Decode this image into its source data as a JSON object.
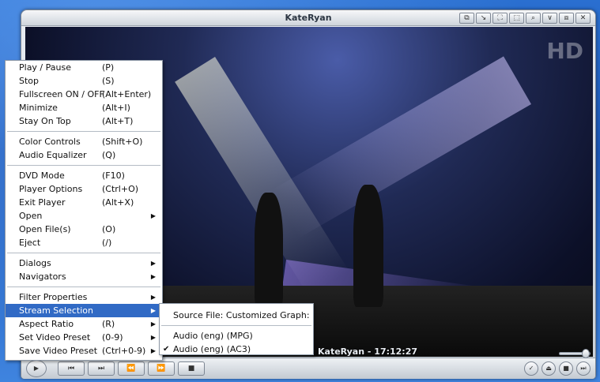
{
  "window": {
    "title": "KateRyan",
    "title_buttons": [
      "⧉",
      "↘",
      "⛶",
      "⬚",
      "⌕",
      "∨",
      "⧈",
      "✕"
    ],
    "title_button_icons": [
      "info-icon",
      "arrow-icon",
      "fullscreen-icon",
      "frame-icon",
      "zoom-icon",
      "chevron-down-icon",
      "restore-icon",
      "close-icon"
    ]
  },
  "video": {
    "overlay_text": "KateRyan - 17:12:27",
    "channel_logo": "HD"
  },
  "menu": {
    "items": [
      {
        "label": "Play / Pause",
        "shortcut": "(P)"
      },
      {
        "label": "Stop",
        "shortcut": "(S)"
      },
      {
        "label": "Fullscreen ON / OFF",
        "shortcut": "(Alt+Enter)"
      },
      {
        "label": "Minimize",
        "shortcut": "(Alt+I)"
      },
      {
        "label": "Stay On Top",
        "shortcut": "(Alt+T)"
      },
      {
        "separator": true
      },
      {
        "label": "Color Controls",
        "shortcut": "(Shift+O)"
      },
      {
        "label": "Audio Equalizer",
        "shortcut": "(Q)"
      },
      {
        "separator": true
      },
      {
        "label": "DVD Mode",
        "shortcut": "(F10)"
      },
      {
        "label": "Player Options",
        "shortcut": "(Ctrl+O)"
      },
      {
        "label": "Exit Player",
        "shortcut": "(Alt+X)"
      },
      {
        "label": "Open",
        "shortcut": "",
        "submenu": true
      },
      {
        "label": "Open File(s)",
        "shortcut": "(O)"
      },
      {
        "label": "Eject",
        "shortcut": "(/)"
      },
      {
        "separator": true
      },
      {
        "label": "Dialogs",
        "shortcut": "",
        "submenu": true
      },
      {
        "label": "Navigators",
        "shortcut": "",
        "submenu": true
      },
      {
        "separator": true
      },
      {
        "label": "Filter Properties",
        "shortcut": "",
        "submenu": true
      },
      {
        "label": "Stream Selection",
        "shortcut": "",
        "submenu": true,
        "highlighted": true
      },
      {
        "label": "Aspect Ratio",
        "shortcut": "(R)",
        "submenu": true
      },
      {
        "label": "Set Video Preset",
        "shortcut": "(0-9)",
        "submenu": true
      },
      {
        "label": "Save Video Preset",
        "shortcut": "(Ctrl+0-9)",
        "submenu": true
      }
    ]
  },
  "submenu": {
    "header": "Source File: Customized Graph:",
    "items": [
      {
        "label": "Audio (eng) (MPG)",
        "checked": false
      },
      {
        "label": "Audio (eng) (AC3)",
        "checked": true
      }
    ]
  },
  "controls": {
    "buttons": [
      "▶",
      "⏮",
      "⏭",
      "⏪",
      "⏩",
      "■"
    ],
    "button_icons": [
      "play-icon",
      "previous-icon",
      "next-icon",
      "rewind-icon",
      "fast-forward-icon",
      "stop-icon"
    ],
    "right_buttons": [
      "✓",
      "⏏",
      "■",
      "⏭"
    ],
    "right_button_icons": [
      "check-icon",
      "eject-icon",
      "stop-small-icon",
      "skip-icon"
    ],
    "volume": 0.85
  },
  "colors": {
    "highlight": "#316ac5",
    "desktop": "#2a6fd0"
  }
}
